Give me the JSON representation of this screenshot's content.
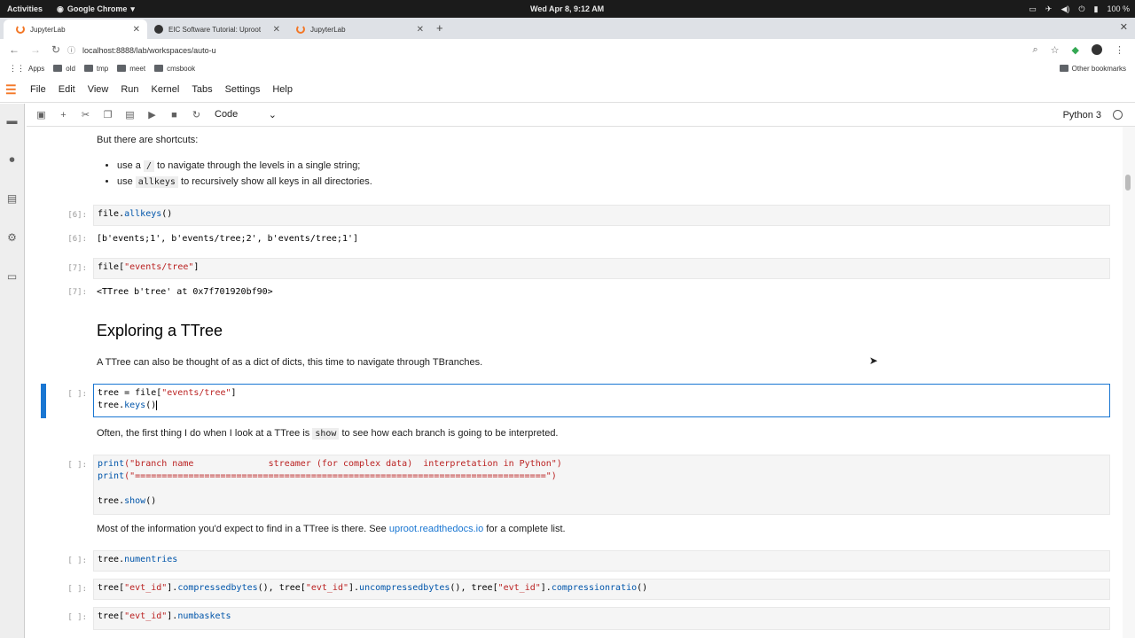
{
  "os": {
    "activities": "Activities",
    "app_name": "Google Chrome",
    "clock": "Wed Apr 8,  9:12 AM",
    "battery": "100 %"
  },
  "browser": {
    "tabs": [
      {
        "label": "JupyterLab",
        "active": true
      },
      {
        "label": "EIC Software Tutorial: Uproot",
        "active": false
      },
      {
        "label": "JupyterLab",
        "active": false
      }
    ],
    "url": "localhost:8888/lab/workspaces/auto-u",
    "bookmarks": [
      "Apps",
      "old",
      "tmp",
      "meet",
      "cmsbook"
    ],
    "other_bookmarks": "Other bookmarks"
  },
  "jupyter": {
    "menu": [
      "File",
      "Edit",
      "View",
      "Run",
      "Kernel",
      "Tabs",
      "Settings",
      "Help"
    ],
    "cell_type": "Code",
    "kernel": "Python 3"
  },
  "notebook": {
    "md_shortcuts": "But there are shortcuts:",
    "bullet1_pre": "use a ",
    "bullet1_code": "/",
    "bullet1_post": " to navigate through the levels in a single string;",
    "bullet2_pre": "use ",
    "bullet2_code": "allkeys",
    "bullet2_post": " to recursively show all keys in all directories.",
    "cell6_prompt": "[6]:",
    "cell6_obj": "file.",
    "cell6_fn": "allkeys",
    "cell6_paren": "()",
    "out6_prompt": "[6]:",
    "out6": "[b'events;1', b'events/tree;2', b'events/tree;1']",
    "cell7_prompt": "[7]:",
    "cell7_pre": "file[",
    "cell7_str": "\"events/tree\"",
    "cell7_post": "]",
    "out7_prompt": "[7]:",
    "out7": "<TTree b'tree' at 0x7f701920bf90>",
    "heading": "Exploring a TTree",
    "md_ttree": "A TTree can also be thought of as a dict of dicts, this time to navigate through TBranches.",
    "cell8_prompt": "[ ]:",
    "cell8_l1_pre": "tree = file[",
    "cell8_l1_str": "\"events/tree\"",
    "cell8_l1_post": "]",
    "cell8_l2_obj": "tree.",
    "cell8_l2_fn": "keys",
    "cell8_l2_paren": "()",
    "md_show_pre": "Often, the first thing I do when I look at a TTree is ",
    "md_show_code": "show",
    "md_show_post": " to see how each branch is going to be interpreted.",
    "cell9_prompt": "[ ]:",
    "cell9_l1_fn": "print",
    "cell9_l1_str": "(\"branch name              streamer (for complex data)  interpretation in Python\")",
    "cell9_l2_fn": "print",
    "cell9_l2_str": "(\"=============================================================================\")",
    "cell9_l4_obj": "tree.",
    "cell9_l4_fn": "show",
    "cell9_l4_paren": "()",
    "md_info_pre": "Most of the information you'd expect to find in a TTree is there. See ",
    "md_info_link": "uproot.readthedocs.io",
    "md_info_post": " for a complete list.",
    "cell10_prompt": "[ ]:",
    "cell10_obj": "tree.",
    "cell10_fn": "numentries",
    "cell11_prompt": "[ ]:",
    "cell11_a": "tree[",
    "cell11_s1": "\"evt_id\"",
    "cell11_b": "].",
    "cell11_f1": "compressedbytes",
    "cell11_c": "(), tree[",
    "cell11_s2": "\"evt_id\"",
    "cell11_d": "].",
    "cell11_f2": "uncompressedbytes",
    "cell11_e": "(), tree[",
    "cell11_s3": "\"evt_id\"",
    "cell11_g": "].",
    "cell11_f3": "compressionratio",
    "cell11_h": "()",
    "cell12_prompt": "[ ]:",
    "cell12_a": "tree[",
    "cell12_s": "\"evt_id\"",
    "cell12_b": "].",
    "cell12_f": "numbaskets"
  }
}
